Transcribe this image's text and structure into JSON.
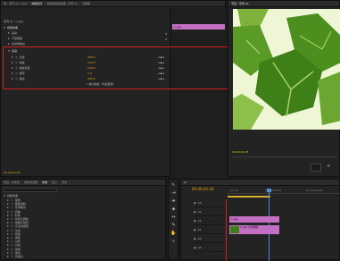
{
  "effects_panel": {
    "tabs": [
      "源：序列 01: 1.jpg",
      "效果控件",
      "音频剪辑混合器：序列 01",
      "元数据"
    ],
    "clip_header": "序列 01 * 1.jpg",
    "clip_label": "1.jpg",
    "sections": [
      "视频效果",
      "运动",
      "不透明度",
      "时间重映射"
    ],
    "motion": {
      "label": "运动",
      "props": [
        {
          "name": "位置",
          "value": "360.0"
        },
        {
          "name": "缩放",
          "value": "100.0"
        },
        {
          "name": "缩放宽度",
          "value": "100.0"
        },
        {
          "name": "旋转",
          "value": "0.0"
        },
        {
          "name": "锚点",
          "value": "360.0"
        }
      ],
      "uniform_scale": "等比缩放（勾选其他）"
    },
    "timecode": "00:00:04:18"
  },
  "program_monitor": {
    "title": "节目：序列 01",
    "timecode": "00:00:04:18"
  },
  "project_panel": {
    "tabs": [
      "项目：未命名",
      "媒体浏览器",
      "效果",
      "标记",
      "历史"
    ],
    "header": "视频效果",
    "items": [
      "变换",
      "图像控制",
      "实用程序",
      "扭曲",
      "时间",
      "杂色与颗粒",
      "模糊与锐化",
      "沉浸式视频",
      "生成",
      "视频",
      "调整",
      "过时",
      "过渡",
      "透视",
      "通道",
      "风格化"
    ]
  },
  "timeline": {
    "timecode": "00:00:04:18",
    "tracks": [
      "V3",
      "V2",
      "V1",
      "A1",
      "A2",
      "A3"
    ],
    "clip_v1": "1.jpg",
    "clip_v2": "2.jpg 不透明度",
    "ruler": [
      "00:00",
      "00:00:05:00",
      "00:00:10:00"
    ]
  },
  "colors": {
    "accent": "#e6a817",
    "clip": "#c36fc3",
    "highlight_red": "#d02020",
    "monitor_timecode": "#e6c800"
  }
}
